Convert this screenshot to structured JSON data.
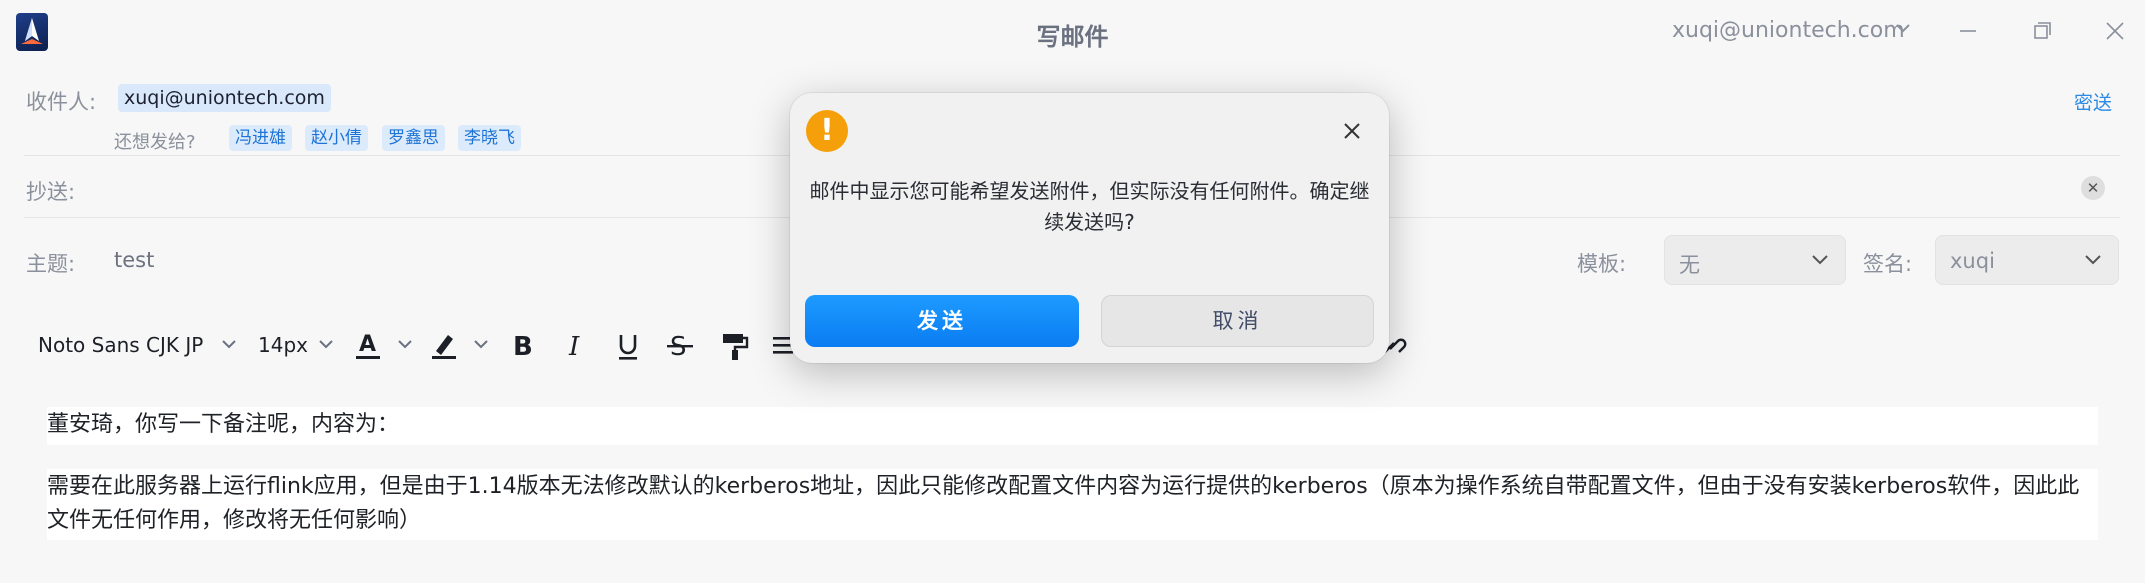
{
  "window": {
    "title": "写邮件",
    "account": "xuqi@uniontech.com"
  },
  "recipients": {
    "to_label": "收件人:",
    "to_chip": "xuqi@uniontech.com",
    "suggest_label": "还想发给?",
    "suggestions": [
      "冯进雄",
      "赵小倩",
      "罗鑫思",
      "李晓飞"
    ],
    "bcc_link": "密送",
    "cc_label": "抄送:"
  },
  "subject": {
    "label": "主题:",
    "value": "test",
    "template_label": "模板:",
    "template_value": "无",
    "signature_label": "签名:",
    "signature_value": "xuqi"
  },
  "toolbar": {
    "font_family": "Noto Sans CJK JP",
    "font_size": "14px"
  },
  "body": {
    "line1": "董安琦，你写一下备注呢，内容为：",
    "line2": "需要在此服务器上运行flink应用，但是由于1.14版本无法修改默认的kerberos地址，因此只能修改配置文件内容为运行提供的kerberos（原本为操作系统自带配置文件，但由于没有安装kerberos软件，因此此文件无任何作用，修改将无任何影响）"
  },
  "dialog": {
    "message": "邮件中显示您可能希望发送附件，但实际没有任何附件。确定继续发送吗?",
    "send_label": "发送",
    "cancel_label": "取消",
    "warning_glyph": "!"
  },
  "colors": {
    "accent": "#0a7cf2",
    "warning": "#f5a00b",
    "chip_bg": "#dcebfb"
  }
}
